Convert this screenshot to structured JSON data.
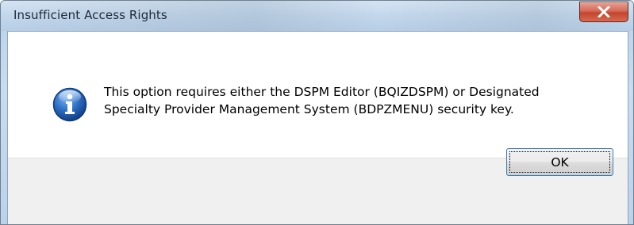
{
  "window": {
    "title": "Insufficient Access Rights",
    "close_icon": "close-icon"
  },
  "dialog": {
    "icon": "info-icon",
    "message_lines": [
      "This option requires either the DSPM Editor (BQIZDSPM) or Designated",
      "Specialty Provider Management System (BDPZMENU) security key."
    ]
  },
  "buttons": {
    "ok_label": "OK"
  },
  "colors": {
    "titlebar": "#c3d7ec",
    "close_button": "#c4452e",
    "button_area": "#f0f0f0",
    "info_icon_blue": "#1e5fb4"
  }
}
